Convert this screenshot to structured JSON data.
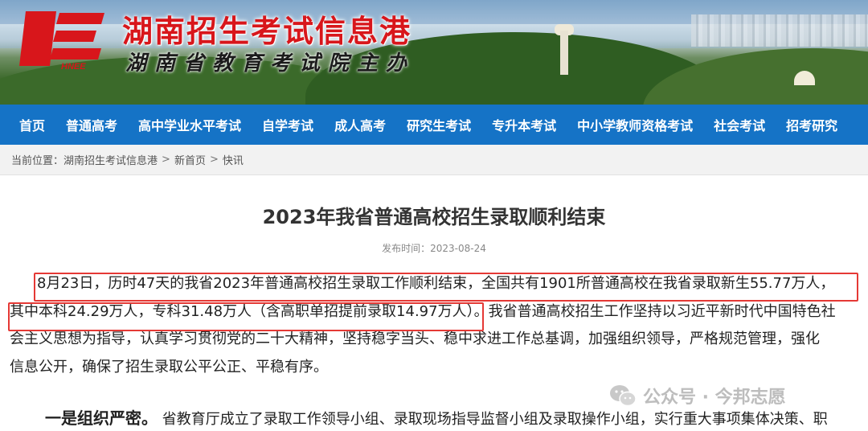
{
  "header": {
    "site_title": "湖南招生考试信息港",
    "site_subtitle": "湖南省教育考试院主办",
    "logo_text": "HNEE"
  },
  "nav": {
    "items": [
      {
        "label": "首页"
      },
      {
        "label": "普通高考"
      },
      {
        "label": "高中学业水平考试"
      },
      {
        "label": "自学考试"
      },
      {
        "label": "成人高考"
      },
      {
        "label": "研究生考试"
      },
      {
        "label": "专升本考试"
      },
      {
        "label": "中小学教师资格考试"
      },
      {
        "label": "社会考试"
      },
      {
        "label": "招考研究"
      }
    ]
  },
  "breadcrumb": {
    "prefix": "当前位置：",
    "items": [
      "湖南招生考试信息港",
      "新首页",
      "快讯"
    ],
    "separator": ">"
  },
  "article": {
    "title": "2023年我省普通高校招生录取顺利结束",
    "publish_time": "发布时间：2023-08-24",
    "para1_line1": "8月23日，历时47天的我省2023年普通高校招生录取工作顺利结束，全国共有1901所普通高校在我省录取新生55.77万人，",
    "para1_line2": "其中本科24.29万人，专科31.48万人（含高职单招提前录取14.97万人）。我省普通高校招生工作坚持以习近平新时代中国特色社",
    "para1_line3": "会主义思想为指导，认真学习贯彻党的二十大精神，坚持稳字当头、稳中求进工作总基调，加强组织领导，严格规范管理，强化",
    "para1_line4": "信息公开，确保了招生录取公平公正、平稳有序。",
    "para2_lead": "一是组织严密。",
    "para2_text": "省教育厅成立了录取工作领导小组、录取现场指导监督小组及录取操作小组，实行重大事项集体决策、职"
  },
  "watermark": {
    "text": "公众号 · 今邦志愿"
  },
  "colors": {
    "brand_red": "#d8161b",
    "nav_blue": "#1573c6",
    "highlight_box": "#e53935"
  }
}
